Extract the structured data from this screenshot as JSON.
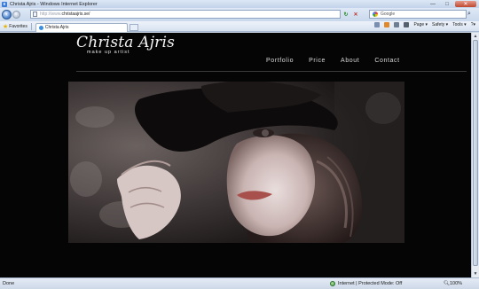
{
  "window": {
    "title": "Christa Ajris - Windows Internet Explorer",
    "minimize": "—",
    "maximize": "□",
    "close": "✕"
  },
  "address_bar": {
    "url_prefix": "http://www.",
    "url_domain": "christaajris.se/"
  },
  "search": {
    "placeholder": "Google"
  },
  "favorites": {
    "label": "Favorites"
  },
  "tab": {
    "title": "Christa Ajris"
  },
  "command_bar": {
    "page": "Page ▾",
    "safety": "Safety ▾",
    "tools": "Tools ▾",
    "help": "?▾"
  },
  "site": {
    "logo_name": "Christa Ajris",
    "logo_tagline": "make up artist",
    "menu": [
      "Portfolio",
      "Price",
      "About",
      "Contact"
    ]
  },
  "status_bar": {
    "left": "Done",
    "zone": "Internet | Protected Mode: Off",
    "zoom": "100%"
  }
}
